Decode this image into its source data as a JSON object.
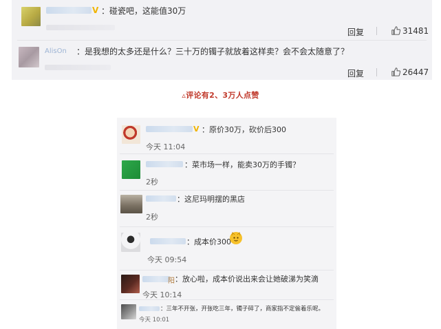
{
  "top_comments": [
    {
      "text": "：碰瓷吧，这能值30万",
      "reply_label": "回复",
      "likes": "31481"
    },
    {
      "name_visible": "AlisOn",
      "text": "：是我想的太多还是什么？三十万的镯子就放着这样卖？会不会太随意了？",
      "reply_label": "回复",
      "likes": "26447"
    }
  ],
  "caption": "▵评论有2、3万人点赞",
  "chat_comments": [
    {
      "text": "：原价30万，砍价后300",
      "time": "今天 11:04"
    },
    {
      "text": "：菜市场一样，能卖30万的手镯？",
      "time": "2秒"
    },
    {
      "text": "：这尼玛明摆的黑店",
      "time": "2秒"
    },
    {
      "text": "：成本价300",
      "time": "今天 09:54"
    },
    {
      "name_visible": "阳",
      "text": "：放心啦，成本价说出来会让她破涕为笑滴",
      "time": "今天 10:14"
    },
    {
      "text": "：三年不开张，开张吃三年，镯子碎了，商家指不定偷着乐呢。",
      "time": "今天 10:01"
    }
  ],
  "colors": {
    "top_bg": "#f2f2f5",
    "chat_bg": "#f4f4f6",
    "caption": "#c0392b",
    "badge": "#f0b400"
  },
  "icons": [
    "thumbs-up-icon",
    "verified-badge-icon",
    "cat-face-emoji-icon"
  ]
}
